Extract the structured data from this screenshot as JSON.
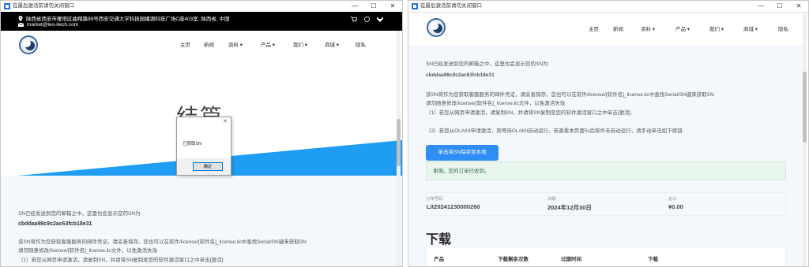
{
  "left_window": {
    "title": "在最后激活前请勿关闭窗口",
    "address": "陕西省西安市雁塔区曲翔路99号西安交通大学科技园播源科技广场C座403室, 陕西省, 中国",
    "email": "market@leo-itech.com",
    "nav": [
      "主页",
      "新闻",
      "资料 ▾",
      "产品 ▾",
      "我们 ▾",
      "商城 ▾",
      "隐私"
    ],
    "hero_text": "结篇",
    "dialog": {
      "close": "✕",
      "message": "已获取SN",
      "ok": "确定"
    },
    "sn_line": "SN已经发送到您的邮箱之中，这里也会显示您的SN为:",
    "sn_code": "cbddaa98c9c2ac63fcb18e31",
    "desc1": "该SN将作为您获取客服服务的邮件凭证，请妥善保存。您也可以在软件/license/[软件名]_license.lic中查找Serial/SN键来获取SN",
    "desc2": "请勿随意修改/license/[软件名]_license.lic文件，以免激活失效",
    "desc3": "（1）若您从网页申请激活，请复制SN，并请将SN复制至您的软件激活窗口之中单击[激活]."
  },
  "right_window": {
    "title": "在最后激活前请勿关闭窗口",
    "nav": [
      "主页",
      "新闻",
      "资料 ▾",
      "产品 ▾",
      "我们 ▾",
      "商城 ▾",
      "隐私"
    ],
    "sn_line": "SN已经发送到您的邮箱之中，这里也会显示您的SN为:",
    "sn_code": "cbddaa98c9c2ac63fcb18e31",
    "desc1": "该SN将作为您获取客服服务的邮件凭证，请妥善保存。您也可以在软件/license/[软件名]_license.lic中查找Serial/SN键来获取SN",
    "desc2": "请勿随意修改/license/[软件名]_license.lic文件，以免激活失效",
    "desc3": "（1）若您从网页申请激活，请复制SN，并请将SN复制至您的软件激活窗口之中单击[激活].",
    "desc4": "（2）若您从OLAKit申请激活，则等待OLAKit自动运行，若查看本页面5s后软件未自动运行，请手动单击如下按钮.",
    "save_button": "单击将SN保存至本地",
    "alert": "谢谢。您的订单已收到。",
    "order": [
      {
        "label": "订单号码:",
        "value": "Lit20241230000260"
      },
      {
        "label": "日期:",
        "value": "2024年12月30日"
      },
      {
        "label": "总计:",
        "value": "¥0.00"
      }
    ],
    "download_heading": "下载",
    "table_headers": [
      "产品",
      "下载剩余次数",
      "过期时间",
      "下载"
    ]
  },
  "window_buttons": {
    "minimize": "—",
    "maximize": "☐",
    "close": "✕"
  },
  "colors": {
    "accent_blue": "#1e9df2",
    "button_blue": "#2f8ef5",
    "alert_green": "#e8f5ed"
  }
}
